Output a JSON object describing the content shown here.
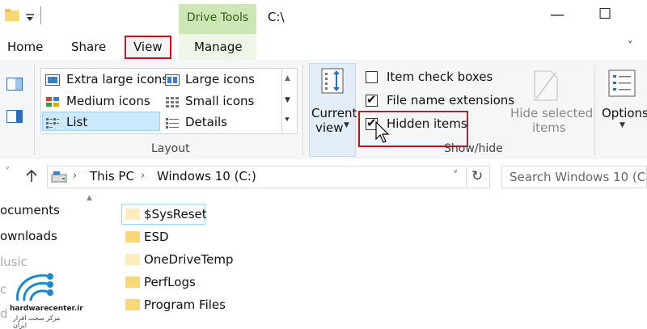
{
  "titlebar": {
    "context_tab": "Drive Tools",
    "path": "C:\\",
    "minimize": "—",
    "maximize": "☐",
    "close": "✕"
  },
  "tabs": [
    "Home",
    "Share",
    "View",
    "Manage"
  ],
  "ribbon": {
    "layout": {
      "items": [
        "Extra large icons",
        "Large icons",
        "Medium icons",
        "Small icons",
        "List",
        "Details"
      ],
      "selected": "List",
      "group_label": "Layout"
    },
    "current_view": {
      "line1": "Current",
      "line2": "view"
    },
    "show_hide": {
      "item_check_boxes": {
        "label": "Item check boxes",
        "checked": false
      },
      "file_name_extensions": {
        "label": "File name extensions",
        "checked": true
      },
      "hidden_items": {
        "label": "Hidden items",
        "checked": true
      },
      "hide_selected": {
        "line1": "Hide selected",
        "line2": "items"
      },
      "group_label": "Show/hide"
    },
    "options": {
      "label": "Options"
    }
  },
  "address": {
    "crumbs": [
      "This PC",
      "Windows 10 (C:)"
    ],
    "search_placeholder": "Search Windows 10 (C:)"
  },
  "nav_pane": [
    "ocuments",
    "ownloads",
    "lusic",
    "c",
    "d"
  ],
  "files": [
    {
      "name": "$SysReset",
      "hidden": true
    },
    {
      "name": "ESD",
      "hidden": false
    },
    {
      "name": "OneDriveTemp",
      "hidden": true
    },
    {
      "name": "PerfLogs",
      "hidden": false
    },
    {
      "name": "Program Files",
      "hidden": false
    }
  ],
  "logo": {
    "text": "hardwarecenter.ir",
    "subtext": "مرکز سخت افزار ایران"
  },
  "colors": {
    "highlight_red": "#c0111f",
    "drive_tools_green": "#cde6b6",
    "selection_blue": "#cce8ff",
    "folder_yellow": "#f8d775"
  }
}
